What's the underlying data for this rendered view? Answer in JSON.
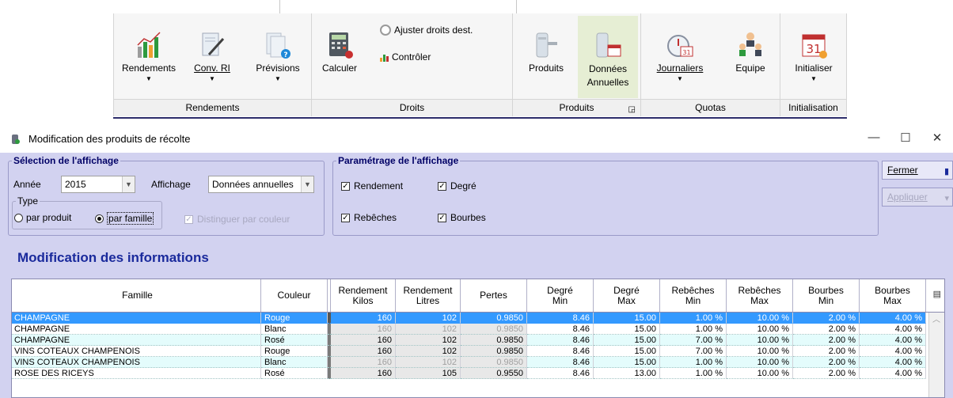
{
  "ribbon": {
    "groups": [
      {
        "label": "Rendements",
        "buttons": [
          {
            "label": "Rendements",
            "icon": "bar-chart-icon",
            "dropdown": true
          },
          {
            "label": "Conv. RI",
            "icon": "document-pen-icon",
            "dropdown": true
          },
          {
            "label": "Prévisions",
            "icon": "document-help-icon",
            "dropdown": true
          }
        ]
      },
      {
        "label": "Droits",
        "buttons": [
          {
            "label": "Calculer",
            "icon": "calculator-icon"
          },
          {
            "label": "Ajuster droits dest.",
            "icon": "gear-icon"
          },
          {
            "label": "Contrôler",
            "icon": "mini-chart-icon"
          }
        ]
      },
      {
        "label": "Produits",
        "buttons": [
          {
            "label": "Produits",
            "icon": "tank-icon"
          },
          {
            "label": "Données Annuelles",
            "icon": "tank-calendar-icon"
          }
        ]
      },
      {
        "label": "Quotas",
        "buttons": [
          {
            "label": "Journaliers",
            "icon": "stopwatch-icon",
            "dropdown": true
          },
          {
            "label": "Equipe",
            "icon": "team-icon"
          }
        ]
      },
      {
        "label": "Initialisation",
        "buttons": [
          {
            "label": "Initialiser",
            "icon": "calendar-31-icon",
            "dropdown": true
          }
        ]
      }
    ],
    "calendar_number": "31"
  },
  "window": {
    "title": "Modification des produits de récolte",
    "controls": {
      "minimize": "—",
      "maximize": "☐",
      "close": "✕"
    }
  },
  "selection": {
    "legend": "Sélection de l'affichage",
    "annee_label": "Année",
    "annee_value": "2015",
    "affichage_label": "Affichage",
    "affichage_value": "Données annuelles",
    "type_legend": "Type",
    "radio_produit": "par produit",
    "radio_famille": "par famille",
    "radio_selected": "par famille",
    "distinguer": "Distinguer par couleur"
  },
  "parametrage": {
    "legend": "Paramétrage de l'affichage",
    "rendement": "Rendement",
    "degre": "Degré",
    "rebeches": "Rebêches",
    "bourbes": "Bourbes",
    "check_mark": "✓"
  },
  "buttons": {
    "fermer": "Fermer",
    "appliquer": "Appliquer"
  },
  "section_title": "Modification des informations",
  "table": {
    "headers": {
      "famille": "Famille",
      "couleur": "Couleur",
      "rend_kilos": "Rendement\nKilos",
      "rend_litres": "Rendement\nLitres",
      "pertes": "Pertes",
      "degre_min": "Degré\nMin",
      "degre_max": "Degré\nMax",
      "reb_min": "Rebêches\nMin",
      "reb_max": "Rebêches\nMax",
      "bourbes_min": "Bourbes\nMin",
      "bourbes_max": "Bourbes\nMax"
    },
    "rows": [
      {
        "famille": "CHAMPAGNE",
        "couleur": "Rouge",
        "rk": "160",
        "rl": "102",
        "pertes": "0.9850",
        "dmin": "8.46",
        "dmax": "15.00",
        "rmin": "1.00 %",
        "rmax": "10.00 %",
        "bmin": "2.00 %",
        "bmax": "4.00 %"
      },
      {
        "famille": "CHAMPAGNE",
        "couleur": "Blanc",
        "rk": "160",
        "rl": "102",
        "pertes": "0.9850",
        "dmin": "8.46",
        "dmax": "15.00",
        "rmin": "1.00 %",
        "rmax": "10.00 %",
        "bmin": "2.00 %",
        "bmax": "4.00 %"
      },
      {
        "famille": "CHAMPAGNE",
        "couleur": "Rosé",
        "rk": "160",
        "rl": "102",
        "pertes": "0.9850",
        "dmin": "8.46",
        "dmax": "15.00",
        "rmin": "7.00 %",
        "rmax": "10.00 %",
        "bmin": "2.00 %",
        "bmax": "4.00 %"
      },
      {
        "famille": "VINS COTEAUX CHAMPENOIS",
        "couleur": "Rouge",
        "rk": "160",
        "rl": "102",
        "pertes": "0.9850",
        "dmin": "8.46",
        "dmax": "15.00",
        "rmin": "7.00 %",
        "rmax": "10.00 %",
        "bmin": "2.00 %",
        "bmax": "4.00 %"
      },
      {
        "famille": "VINS COTEAUX CHAMPENOIS",
        "couleur": "Blanc",
        "rk": "160",
        "rl": "102",
        "pertes": "0.9850",
        "dmin": "8.46",
        "dmax": "15.00",
        "rmin": "1.00 %",
        "rmax": "10.00 %",
        "bmin": "2.00 %",
        "bmax": "4.00 %"
      },
      {
        "famille": "ROSE DES RICEYS",
        "couleur": "Rosé",
        "rk": "160",
        "rl": "105",
        "pertes": "0.9550",
        "dmin": "8.46",
        "dmax": "13.00",
        "rmin": "1.00 %",
        "rmax": "10.00 %",
        "bmin": "2.00 %",
        "bmax": "4.00 %"
      }
    ]
  },
  "colors": {
    "selected_row": "#3399ff",
    "panel_bg": "#d2d2f0",
    "title_blue": "#1a2a9c",
    "alt_row": "#e4fcfc"
  }
}
